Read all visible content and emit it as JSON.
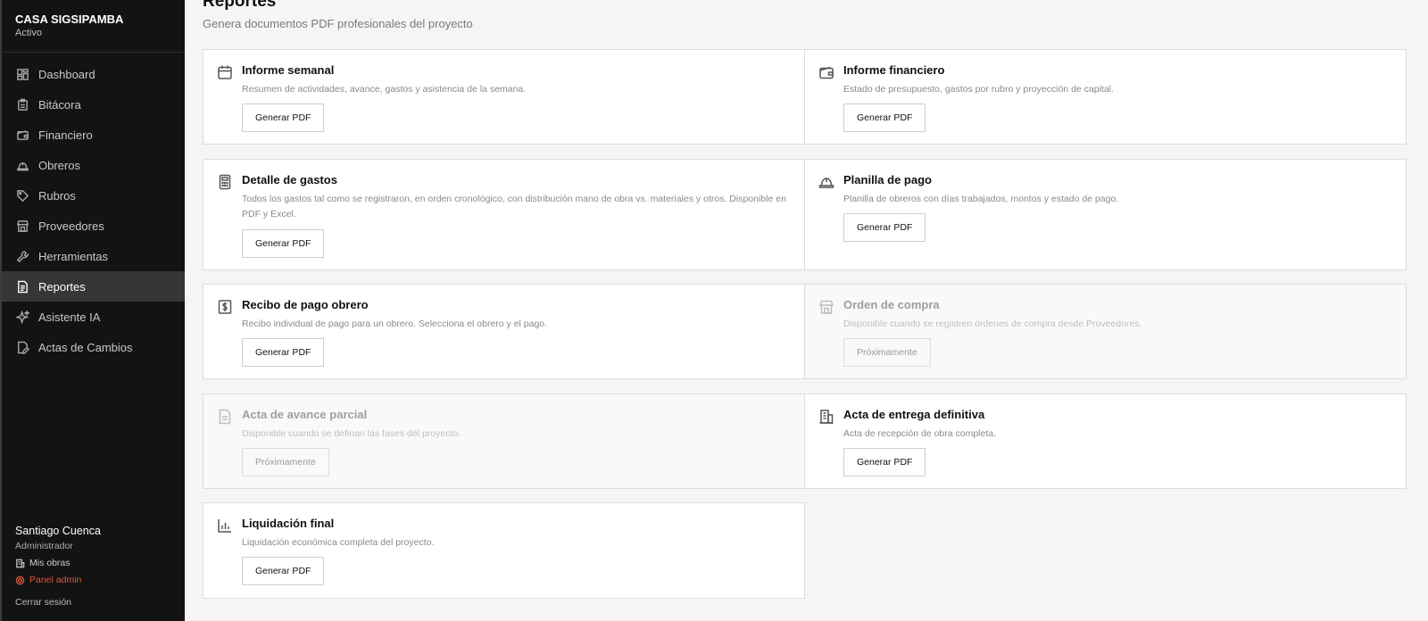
{
  "sidebar": {
    "project_name": "CASA SIGSIPAMBA",
    "project_status": "Activo",
    "items": [
      {
        "label": "Dashboard",
        "icon": "dashboard-icon"
      },
      {
        "label": "Bitácora",
        "icon": "clipboard-icon"
      },
      {
        "label": "Financiero",
        "icon": "wallet-icon"
      },
      {
        "label": "Obreros",
        "icon": "hardhat-icon"
      },
      {
        "label": "Rubros",
        "icon": "tag-icon"
      },
      {
        "label": "Proveedores",
        "icon": "store-icon"
      },
      {
        "label": "Herramientas",
        "icon": "wrench-icon"
      },
      {
        "label": "Reportes",
        "icon": "file-text-icon",
        "active": true
      },
      {
        "label": "Asistente IA",
        "icon": "sparkles-icon"
      },
      {
        "label": "Actas de Cambios",
        "icon": "file-edit-icon"
      }
    ],
    "user": {
      "name": "Santiago Cuenca",
      "role": "Administrador",
      "mis_obras": "Mis obras",
      "panel_admin": "Panel admin",
      "logout": "Cerrar sesión"
    }
  },
  "main": {
    "title": "Reportes",
    "subtitle": "Genera documentos PDF profesionales del proyecto",
    "cards": [
      {
        "title": "Informe semanal",
        "desc": "Resumen de actividades, avance, gastos y asistencia de la semana.",
        "button": "Generar PDF",
        "icon": "calendar-icon"
      },
      {
        "title": "Informe financiero",
        "desc": "Estado de presupuesto, gastos por rubro y proyección de capital.",
        "button": "Generar PDF",
        "icon": "wallet-icon"
      },
      {
        "title": "Detalle de gastos",
        "desc": "Todos los gastos tal como se registraron, en orden cronológico, con distribución mano de obra vs. materiales y otros. Disponible en PDF y Excel.",
        "button": "Generar PDF",
        "icon": "calculator-icon"
      },
      {
        "title": "Planilla de pago",
        "desc": "Planilla de obreros con días trabajados, montos y estado de pago.",
        "button": "Generar PDF",
        "icon": "hardhat-icon"
      },
      {
        "title": "Recibo de pago obrero",
        "desc": "Recibo individual de pago para un obrero. Selecciona el obrero y el pago.",
        "button": "Generar PDF",
        "icon": "receipt-dollar-icon"
      },
      {
        "title": "Orden de compra",
        "desc": "Disponible cuando se registren órdenes de compra desde Proveedores.",
        "button": "Próximamente",
        "icon": "store-icon",
        "disabled": true
      },
      {
        "title": "Acta de avance parcial",
        "desc": "Disponible cuando se definan las fases del proyecto.",
        "button": "Próximamente",
        "icon": "file-icon",
        "disabled": true
      },
      {
        "title": "Acta de entrega definitiva",
        "desc": "Acta de recepción de obra completa.",
        "button": "Generar PDF",
        "icon": "building-icon"
      },
      {
        "title": "Liquidación final",
        "desc": "Liquidación económica completa del proyecto.",
        "button": "Generar PDF",
        "icon": "bar-chart-icon"
      }
    ]
  }
}
